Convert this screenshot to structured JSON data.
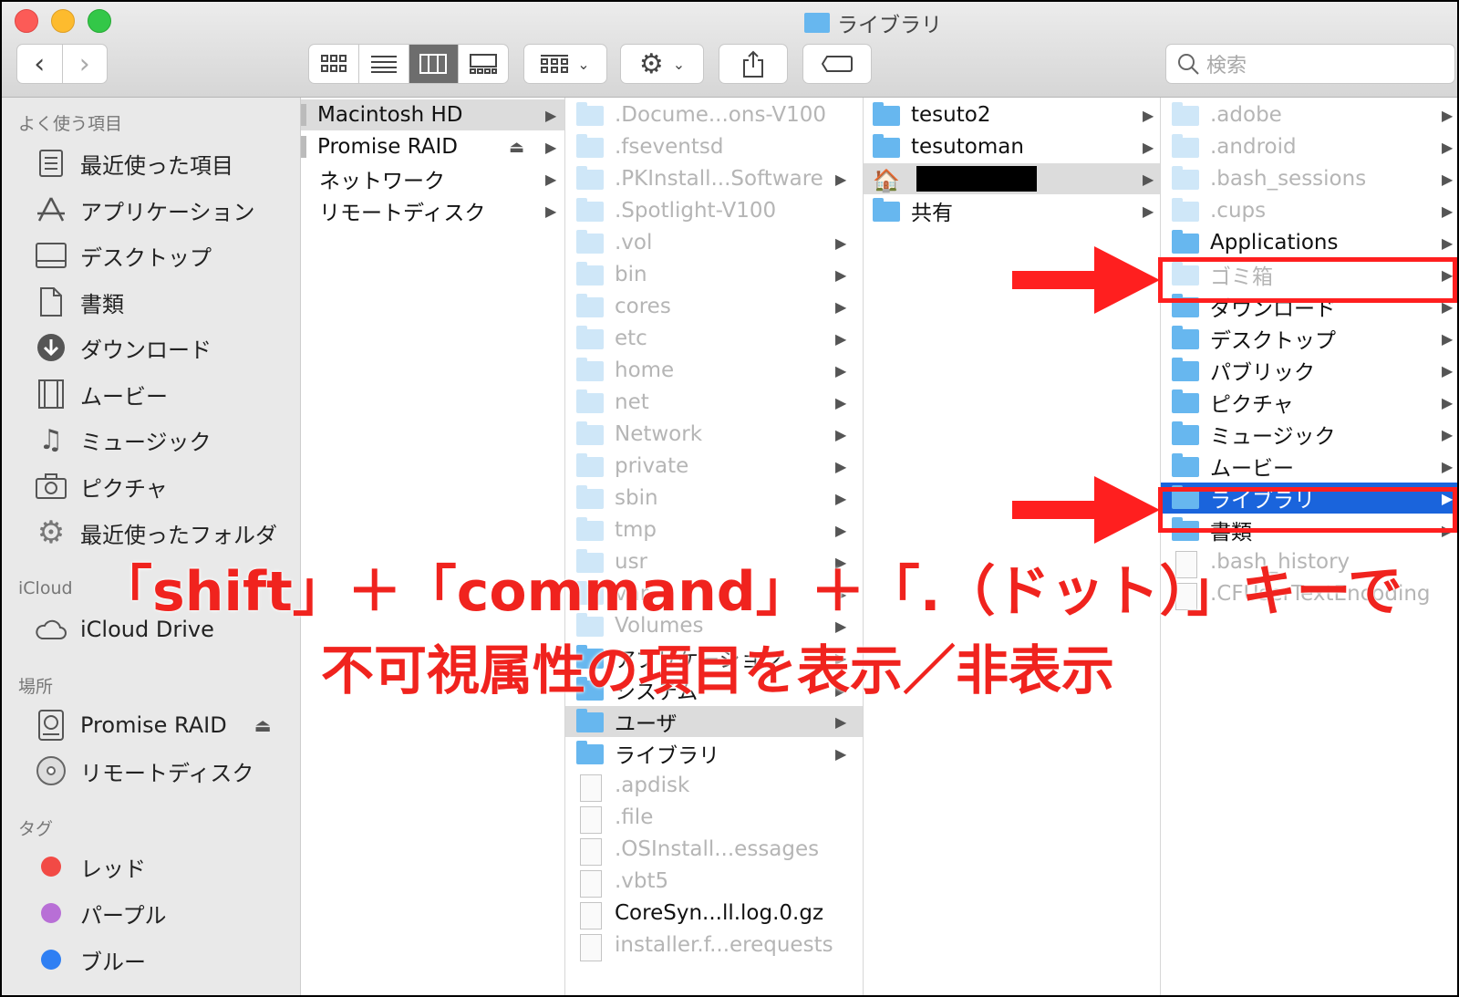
{
  "window": {
    "title": "ライブラリ",
    "search_placeholder": "検索"
  },
  "sidebar": {
    "favorites_header": "よく使う項目",
    "favorites": [
      {
        "label": "最近使った項目",
        "icon": "recents-icon"
      },
      {
        "label": "アプリケーション",
        "icon": "applications-icon"
      },
      {
        "label": "デスクトップ",
        "icon": "desktop-icon"
      },
      {
        "label": "書類",
        "icon": "documents-icon"
      },
      {
        "label": "ダウンロード",
        "icon": "downloads-icon"
      },
      {
        "label": "ムービー",
        "icon": "movies-icon"
      },
      {
        "label": "ミュージック",
        "icon": "music-icon"
      },
      {
        "label": "ピクチャ",
        "icon": "pictures-icon"
      },
      {
        "label": "最近使ったフォルダ",
        "icon": "gear-icon"
      }
    ],
    "icloud_header": "iCloud",
    "icloud": [
      {
        "label": "iCloud Drive",
        "icon": "cloud-icon"
      }
    ],
    "locations_header": "場所",
    "locations": [
      {
        "label": "Promise RAID",
        "icon": "disk-icon"
      },
      {
        "label": "リモートディスク",
        "icon": "remote-disc-icon"
      }
    ],
    "tags_header": "タグ",
    "tags": [
      {
        "label": "レッド",
        "color": "#f24a45"
      },
      {
        "label": "パープル",
        "color": "#b86fd6"
      },
      {
        "label": "ブルー",
        "color": "#2f7ff3"
      }
    ]
  },
  "columns": {
    "col1": [
      {
        "name": "Macintosh HD"
      },
      {
        "name": "Promise RAID"
      },
      {
        "name": "ネットワーク"
      },
      {
        "name": "リモートディスク"
      }
    ],
    "col2": [
      {
        "name": ".Docume...ons-V100"
      },
      {
        "name": ".fseventsd"
      },
      {
        "name": ".PKInstall...Software"
      },
      {
        "name": ".Spotlight-V100"
      },
      {
        "name": ".vol"
      },
      {
        "name": "bin"
      },
      {
        "name": "cores"
      },
      {
        "name": "etc"
      },
      {
        "name": "home"
      },
      {
        "name": "net"
      },
      {
        "name": "Network"
      },
      {
        "name": "private"
      },
      {
        "name": "sbin"
      },
      {
        "name": "tmp"
      },
      {
        "name": "usr"
      },
      {
        "name": "var"
      },
      {
        "name": "Volumes"
      },
      {
        "name": "アプリケーション"
      },
      {
        "name": "システム"
      },
      {
        "name": "ユーザ"
      },
      {
        "name": "ライブラリ"
      },
      {
        "name": ".apdisk"
      },
      {
        "name": ".file"
      },
      {
        "name": ".OSInstall...essages"
      },
      {
        "name": ".vbt5"
      },
      {
        "name": "CoreSyn...ll.log.0.gz"
      },
      {
        "name": "installer.f...erequests"
      }
    ],
    "col3": [
      {
        "name": "tesuto2"
      },
      {
        "name": "tesutoman"
      },
      {
        "name": ""
      },
      {
        "name": "共有"
      }
    ],
    "col4": [
      {
        "name": ".adobe"
      },
      {
        "name": ".android"
      },
      {
        "name": ".bash_sessions"
      },
      {
        "name": ".cups"
      },
      {
        "name": "Applications"
      },
      {
        "name": "ゴミ箱"
      },
      {
        "name": "ダウンロード"
      },
      {
        "name": "デスクトップ"
      },
      {
        "name": "パブリック"
      },
      {
        "name": "ピクチャ"
      },
      {
        "name": "ミュージック"
      },
      {
        "name": "ムービー"
      },
      {
        "name": "ライブラリ"
      },
      {
        "name": "書類"
      },
      {
        "name": ".bash_history"
      },
      {
        "name": ".CFUserTextEncoding"
      }
    ]
  },
  "annotation": {
    "line1": "「shift」＋「command」＋「.（ドット）」キーで",
    "line2": "不可視属性の項目を表示／非表示"
  }
}
